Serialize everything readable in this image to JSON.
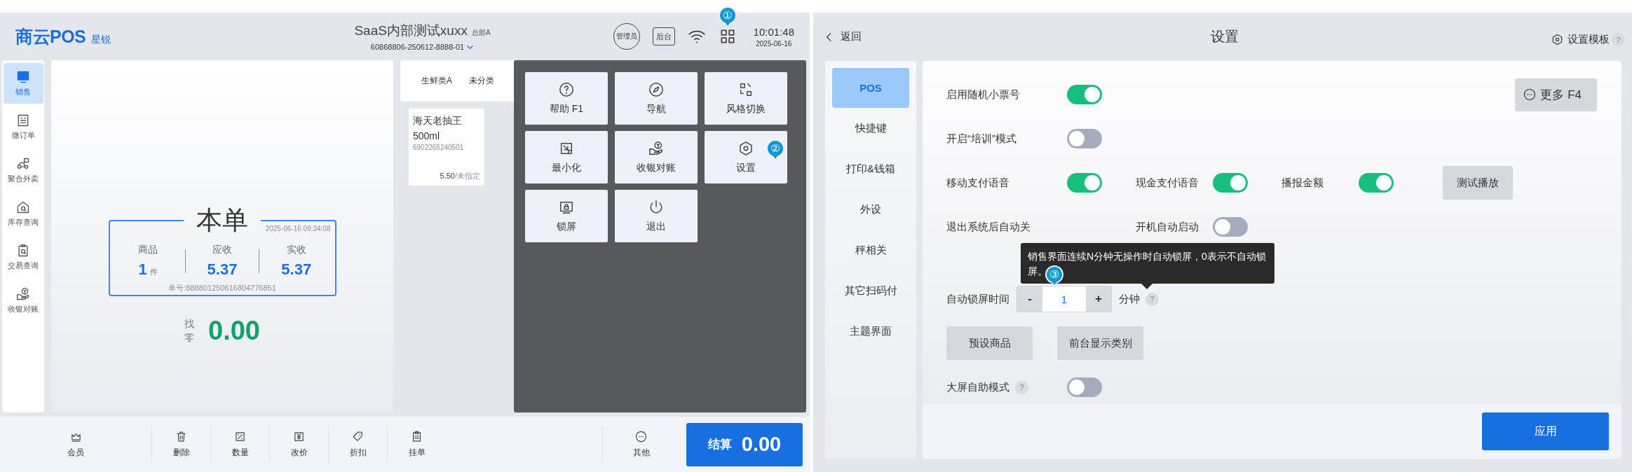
{
  "pos": {
    "header": {
      "logo": "商云POS",
      "logo_sub": "星锐",
      "store": "SaaS内部测试xuxx",
      "branch": "总部A",
      "terminal": "60868806-250612-8888-01",
      "role_badge": "管理员",
      "backend_badge": "后台",
      "marker": "①",
      "time": "10:01:48",
      "date": "2025-06-16"
    },
    "nav": [
      {
        "label": "销售",
        "selected": true
      },
      {
        "label": "微订单",
        "selected": false
      },
      {
        "label": "聚合外卖",
        "selected": false
      },
      {
        "label": "库存查询",
        "selected": false
      },
      {
        "label": "交易查询",
        "selected": false
      },
      {
        "label": "收银对账",
        "selected": false
      }
    ],
    "order": {
      "title": "本单",
      "timestamp": "2025-06-16 09:34:08",
      "stats": [
        {
          "label": "商品",
          "value": "1",
          "unit": "件"
        },
        {
          "label": "应收",
          "value": "5.37"
        },
        {
          "label": "实收",
          "value": "5.37"
        }
      ],
      "order_no": "单号:888801250616804776851",
      "change_label": "找零",
      "change": "0.00"
    },
    "categories": [
      "生鲜类A",
      "未分类"
    ],
    "products": [
      {
        "name": "海天老抽王500ml",
        "barcode": "6902265240501",
        "price": "5.50",
        "unit": "/未指定"
      }
    ],
    "menu": [
      {
        "label": "帮助 F1"
      },
      {
        "label": "导航"
      },
      {
        "label": "风格切换"
      },
      {
        "label": "最小化"
      },
      {
        "label": "收银对账"
      },
      {
        "label": "设置",
        "marker": "②"
      },
      {
        "label": "锁屏"
      },
      {
        "label": "退出"
      }
    ],
    "toolbar": {
      "left": [
        {
          "label": "会员"
        },
        {
          "label": "删除"
        },
        {
          "label": "数量"
        },
        {
          "label": "改价"
        },
        {
          "label": "折扣"
        },
        {
          "label": "挂单"
        }
      ],
      "right": [
        {
          "label": "其他"
        }
      ]
    },
    "checkout": {
      "label": "结算",
      "amount": "0.00"
    }
  },
  "settings": {
    "back": "返回",
    "title": "设置",
    "template": "设置模板",
    "template_help": "?",
    "tabs": [
      {
        "label": "POS",
        "selected": true
      },
      {
        "label": "快捷键",
        "selected": false
      },
      {
        "label": "打印&钱箱",
        "selected": false
      },
      {
        "label": "外设",
        "selected": false
      },
      {
        "label": "秤相关",
        "selected": false
      },
      {
        "label": "其它扫码付",
        "selected": false
      },
      {
        "label": "主题界面",
        "selected": false
      }
    ],
    "rows": [
      {
        "kind": "toggles",
        "items": [
          {
            "label": "启用随机小票号",
            "on": true
          }
        ],
        "aside": "更多 F4"
      },
      {
        "kind": "toggles",
        "items": [
          {
            "label": "开启“培训”模式",
            "on": false
          }
        ]
      },
      {
        "kind": "toggles",
        "items": [
          {
            "label": "移动支付语音",
            "on": true
          },
          {
            "label": "现金支付语音",
            "on": true
          },
          {
            "label": "播报金额",
            "on": true
          }
        ],
        "button": "测试播放"
      },
      {
        "kind": "toggles",
        "items": [
          {
            "label": "退出系统后自动关"
          },
          {
            "label": "开机自动启动",
            "on": false
          }
        ]
      },
      {
        "kind": "stepper",
        "label": "自动锁屏时间",
        "minus": "-",
        "value": "1",
        "plus": "+",
        "unit": "分钟",
        "help": "?",
        "marker": "③"
      },
      {
        "kind": "buttons",
        "buttons": [
          "预设商品",
          "前台显示类别"
        ]
      },
      {
        "kind": "toggles",
        "items": [
          {
            "label": "大屏自助模式",
            "help": "?",
            "on": false
          }
        ]
      }
    ],
    "tooltip": "销售界面连续N分钟无操作时自动锁屏，0表示不自动锁屏。",
    "apply": "应用"
  }
}
